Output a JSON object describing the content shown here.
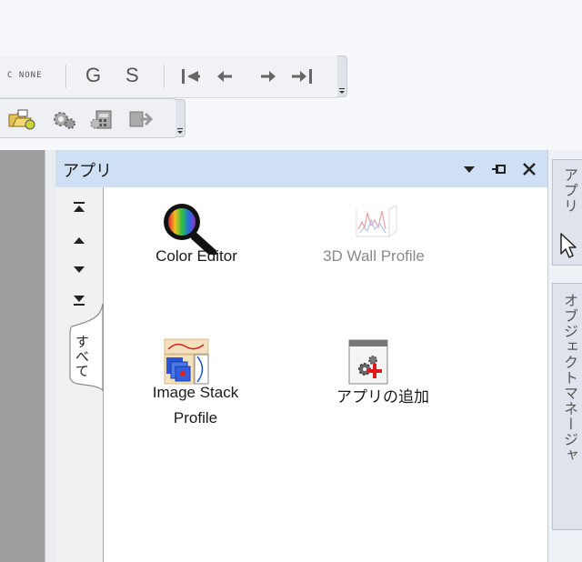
{
  "toolbar1": {
    "display_mode_label": "C NONE",
    "g_label": "G",
    "s_label": "S",
    "icons": [
      "first-frame-icon",
      "prev-frame-icon",
      "next-frame-icon",
      "last-frame-icon"
    ]
  },
  "toolbar2": {
    "icons": [
      "open-folder-icon",
      "gear-tool-icon",
      "calculator-icon",
      "remove-tool-icon"
    ]
  },
  "panel": {
    "title": "アプリ",
    "controls": [
      "dropdown-icon",
      "pin-icon",
      "close-icon"
    ],
    "left_tab_label": "すべて",
    "nav_icons": [
      "scroll-top-icon",
      "scroll-up-icon",
      "scroll-down-icon",
      "scroll-bottom-icon"
    ],
    "apps": [
      {
        "label": "Color Editor",
        "icon": "color-editor-icon",
        "enabled": true
      },
      {
        "label": "3D Wall Profile",
        "icon": "wall-profile-icon",
        "enabled": false
      },
      {
        "label": "Image Stack",
        "label_line2": "Profile",
        "icon": "image-stack-profile-icon",
        "enabled": true
      },
      {
        "label": "アプリの追加",
        "icon": "add-app-icon",
        "enabled": true
      }
    ]
  },
  "sidebar": {
    "tabs": [
      {
        "label": "アプリ"
      },
      {
        "label": "オブジェクトマネージャ"
      }
    ]
  },
  "colors": {
    "panel_title_bg": "#cfe0f5",
    "add_red": "#e01818"
  }
}
